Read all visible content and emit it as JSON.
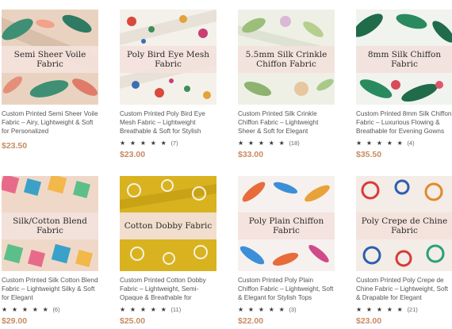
{
  "products": [
    {
      "banner": "Semi Sheer Voile Fabric",
      "description": "Custom Printed Semi Sheer Voile Fabric – Airy, Lightweight & Soft for Personalized",
      "stars": "",
      "reviews": "",
      "price": "$23.50"
    },
    {
      "banner": "Poly Bird Eye Mesh Fabric",
      "description": "Custom Printed Poly Bird Eye Mesh Fabric – Lightweight Breathable & Soft for Stylish",
      "stars": "★ ★ ★ ★ ★",
      "reviews": "(7)",
      "price": "$23.00"
    },
    {
      "banner": "5.5mm Silk Crinkle Chiffon Fabric",
      "description": "Custom Printed Silk Crinkle Chiffon Fabric – Lightweight Sheer & Soft for Elegant",
      "stars": "★ ★ ★ ★ ★",
      "reviews": "(18)",
      "price": "$33.00"
    },
    {
      "banner": "8mm Silk Chiffon Fabric",
      "description": "Custom Printed 8mm Silk Chiffon Fabric – Luxurious Flowing & Breathable for Evening Gowns",
      "stars": "★ ★ ★ ★ ★",
      "reviews": "(4)",
      "price": "$35.50"
    },
    {
      "banner": "Silk/Cotton Blend Fabric",
      "description": "Custom Printed Silk Cotton Blend Fabric – Lightweight Silky & Soft for Elegant",
      "stars": "★ ★ ★ ★ ★",
      "reviews": "(6)",
      "price": "$29.00"
    },
    {
      "banner": "Cotton Dobby Fabric",
      "description": "Custom Printed Cotton Dobby Fabric – Lightweight, Semi-Opaque & Breathable for",
      "stars": "★ ★ ★ ★ ★",
      "reviews": "(11)",
      "price": "$25.00"
    },
    {
      "banner": "Poly Plain Chiffon Fabric",
      "description": "Custom Printed Poly Plain Chiffon Fabric – Lightweight, Soft & Elegant for Stylish Tops",
      "stars": "★ ★ ★ ★ ★",
      "reviews": "(3)",
      "price": "$22.00"
    },
    {
      "banner": "Poly Crepe de Chine Fabric",
      "description": "Custom Printed Poly Crepe de Chine Fabric – Lightweight, Soft & Drapable for Elegant",
      "stars": "★ ★ ★ ★ ★",
      "reviews": "(21)",
      "price": "$23.00"
    }
  ],
  "colors": {
    "price": "#c98a62",
    "banner_bg": "#f3e2dc"
  }
}
